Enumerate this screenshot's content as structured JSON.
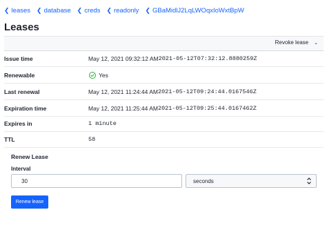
{
  "breadcrumb": [
    {
      "label": "leases"
    },
    {
      "label": "database"
    },
    {
      "label": "creds"
    },
    {
      "label": "readonly"
    },
    {
      "label": "GBaMidlJ2LqLWOqxIoWxtBpW"
    }
  ],
  "page_title": "Leases",
  "toolbar": {
    "revoke_label": "Revoke lease"
  },
  "details": {
    "issue_time": {
      "label": "Issue time",
      "value": "May 12, 2021 09:32:12 AM",
      "raw": "2021-05-12T07:32:12.8880259Z"
    },
    "renewable": {
      "label": "Renewable",
      "value": "Yes"
    },
    "last_renewal": {
      "label": "Last renewal",
      "value": "May 12, 2021 11:24:44 AM",
      "raw": "2021-05-12T09:24:44.0167546Z"
    },
    "expiration_time": {
      "label": "Expiration time",
      "value": "May 12, 2021 11:25:44 AM",
      "raw": "2021-05-12T09:25:44.0167462Z"
    },
    "expires_in": {
      "label": "Expires in",
      "value": "1 minute"
    },
    "ttl": {
      "label": "TTL",
      "value": "58"
    }
  },
  "renew": {
    "title": "Renew Lease",
    "interval_label": "Interval",
    "interval_value": "30",
    "unit_selected": "seconds",
    "button_label": "Renew lease"
  },
  "colors": {
    "accent": "#1563ff",
    "success": "#2eb039"
  }
}
